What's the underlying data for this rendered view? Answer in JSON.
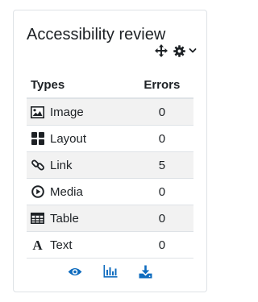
{
  "block": {
    "title": "Accessibility review",
    "controls": [
      {
        "name": "move-icon"
      },
      {
        "name": "gear-icon"
      },
      {
        "name": "caret-down-icon"
      }
    ]
  },
  "table": {
    "headers": {
      "type": "Types",
      "errors": "Errors"
    },
    "rows": [
      {
        "type": "Image",
        "errors": "0",
        "icon": "image-icon"
      },
      {
        "type": "Layout",
        "errors": "0",
        "icon": "layout-icon"
      },
      {
        "type": "Link",
        "errors": "5",
        "icon": "link-icon"
      },
      {
        "type": "Media",
        "errors": "0",
        "icon": "media-play-icon"
      },
      {
        "type": "Table",
        "errors": "0",
        "icon": "table-icon"
      },
      {
        "type": "Text",
        "errors": "0",
        "icon": "text-icon",
        "glyph": "A"
      }
    ]
  },
  "footer": {
    "actions": [
      {
        "name": "eye-icon"
      },
      {
        "name": "bar-chart-icon"
      },
      {
        "name": "download-icon"
      }
    ]
  },
  "colors": {
    "accent": "#0f6cbf",
    "text": "#1d2125",
    "border": "#dee2e6",
    "stripe": "#f2f2f2"
  }
}
